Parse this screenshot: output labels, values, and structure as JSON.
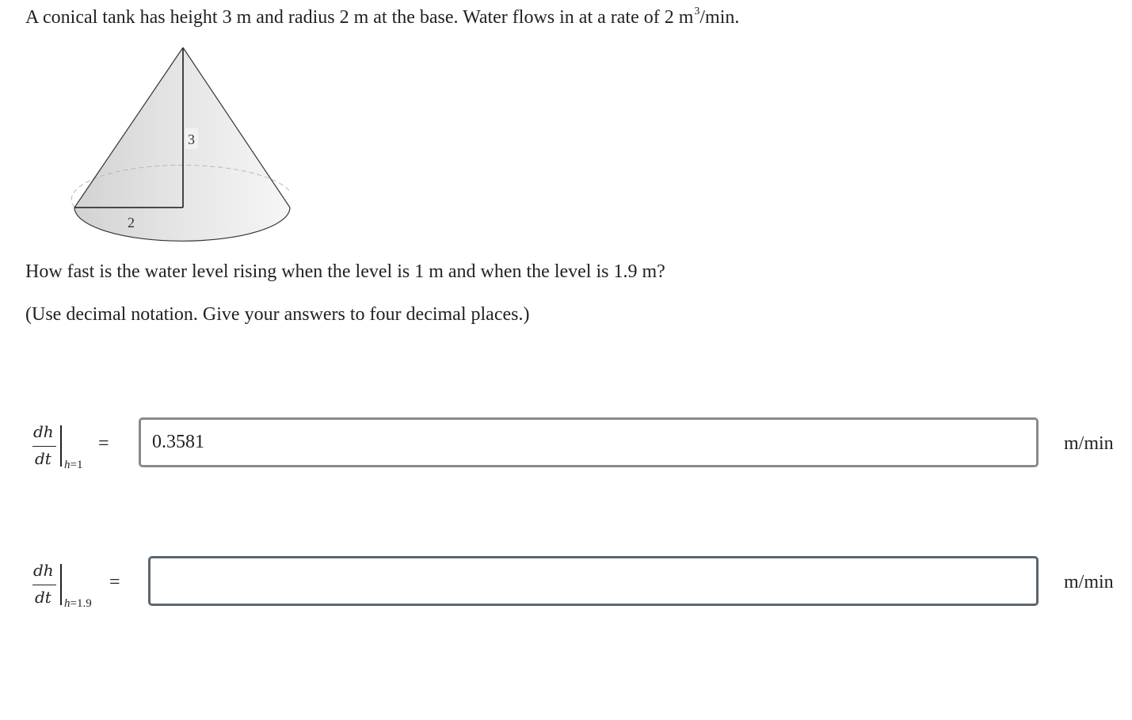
{
  "problem": {
    "statement_pre": "A conical tank has height 3 m and radius 2 m at the base. Water flows in at a rate of 2 m",
    "statement_exp": "3",
    "statement_post": "/min.",
    "question": "How fast is the water level rising when the level is 1 m and when the level is 1.9 m?",
    "instruction": "(Use decimal notation. Give your answers to four decimal places.)"
  },
  "figure": {
    "height_label": "3",
    "radius_label": "2"
  },
  "answers": [
    {
      "numerator": "dh",
      "denominator": "dt",
      "subscript_var": "h",
      "subscript_rest": "=1",
      "equals": "=",
      "value": "0.3581",
      "unit": "m/min"
    },
    {
      "numerator": "dh",
      "denominator": "dt",
      "subscript_var": "h",
      "subscript_rest": "=1.9",
      "equals": "=",
      "value": "",
      "unit": "m/min"
    }
  ]
}
